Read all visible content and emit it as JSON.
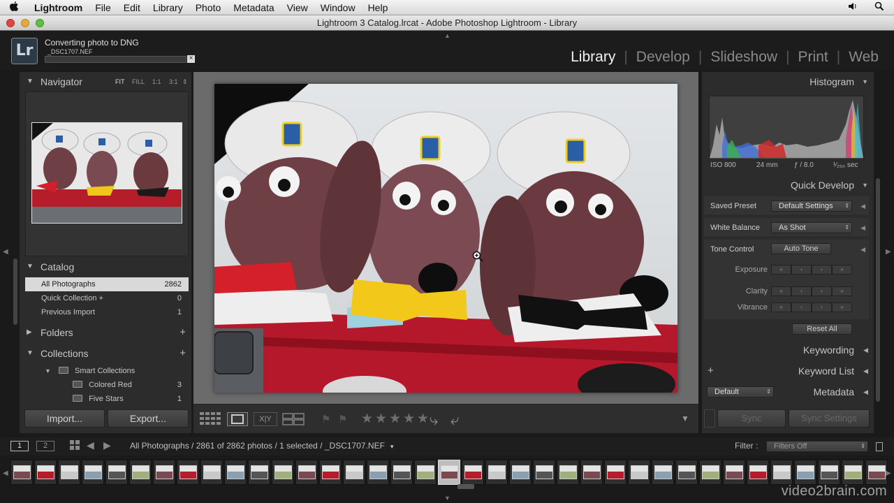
{
  "menubar": {
    "app": "Lightroom",
    "items": [
      "File",
      "Edit",
      "Library",
      "Photo",
      "Metadata",
      "View",
      "Window",
      "Help"
    ]
  },
  "window": {
    "title": "Lightroom 3 Catalog.lrcat - Adobe Photoshop Lightroom - Library"
  },
  "identity": {
    "logo": "Lr",
    "progress_title": "Converting photo to DNG",
    "progress_file": "_DSC1707.NEF",
    "progress_close": "×",
    "progress": 0
  },
  "modules": {
    "items": [
      "Library",
      "Develop",
      "Slideshow",
      "Print",
      "Web"
    ],
    "active": "Library"
  },
  "navigator": {
    "title": "Navigator",
    "options": [
      "FIT",
      "FILL",
      "1:1",
      "3:1"
    ],
    "active_option": "FIT"
  },
  "catalog": {
    "title": "Catalog",
    "rows": [
      {
        "label": "All Photographs",
        "count": "2862"
      },
      {
        "label": "Quick Collection  +",
        "count": "0"
      },
      {
        "label": "Previous Import",
        "count": "1"
      }
    ]
  },
  "folders": {
    "title": "Folders"
  },
  "collections": {
    "title": "Collections",
    "group": "Smart Collections",
    "rows": [
      {
        "label": "Colored Red",
        "count": "3"
      },
      {
        "label": "Five Stars",
        "count": "1"
      }
    ]
  },
  "left_buttons": {
    "import": "Import...",
    "export": "Export..."
  },
  "right": {
    "histogram": "Histogram",
    "histo_info": {
      "iso": "ISO 800",
      "focal": "24 mm",
      "aperture": "ƒ / 8.0",
      "shutter": "¹⁄₂₅₀ sec"
    },
    "quick_develop": "Quick Develop",
    "saved_preset_label": "Saved Preset",
    "saved_preset_value": "Default Settings",
    "white_balance_label": "White Balance",
    "white_balance_value": "As Shot",
    "tone_control_label": "Tone Control",
    "auto_tone": "Auto Tone",
    "exposure": "Exposure",
    "clarity": "Clarity",
    "vibrance": "Vibrance",
    "reset_all": "Reset All",
    "keywording": "Keywording",
    "keyword_list": "Keyword List",
    "metadata": "Metadata",
    "metadata_preset": "Default",
    "sync": "Sync",
    "sync_settings": "Sync Settings"
  },
  "filmbar": {
    "screen1": "1",
    "screen2": "2",
    "source": "All Photographs / 2861 of 2862 photos / 1 selected / _DSC1707.NEF",
    "filter_label": "Filter :",
    "filter_value": "Filters Off"
  },
  "toolbar": {
    "rating": 0,
    "max_rating": 5
  },
  "watermark": "video2brain.com",
  "icons": {
    "apple": "apple-icon",
    "volume": "volume-icon",
    "spotlight": "search-icon"
  },
  "colors": {
    "accent": "#f2f2f2",
    "panel": "#2c2c2c",
    "selected_row": "#d9d9d9"
  }
}
